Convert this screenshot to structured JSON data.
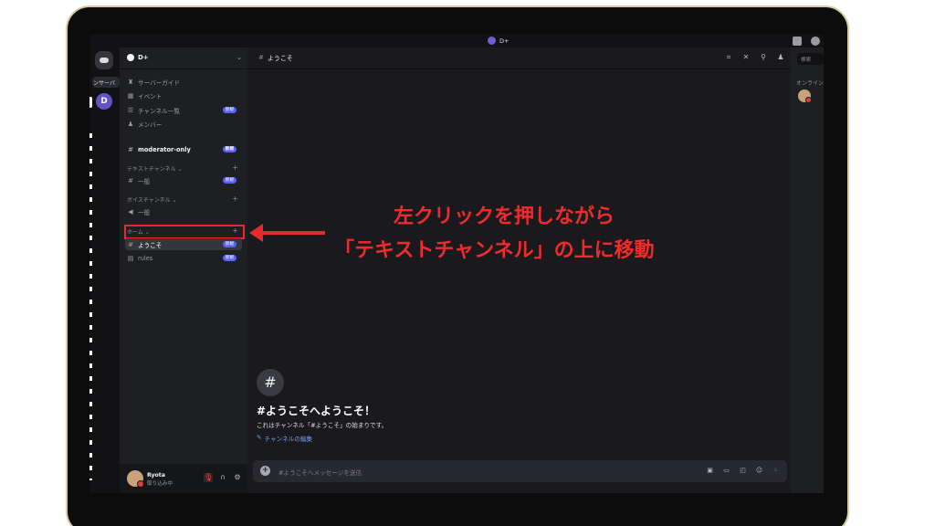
{
  "window": {
    "title": "D+"
  },
  "server_rail": {
    "server_label": "ンサーバ",
    "server_initial": "D"
  },
  "server": {
    "name": "D+"
  },
  "sidebar": {
    "top_items": [
      {
        "label": "サーバーガイド",
        "icon": "guide-icon"
      },
      {
        "label": "イベント",
        "icon": "calendar-icon"
      },
      {
        "label": "チャンネル一覧",
        "icon": "channel-list-icon",
        "badge": "新規"
      },
      {
        "label": "メンバー",
        "icon": "members-icon"
      }
    ],
    "moderator_channel": {
      "label": "moderator-only",
      "badge": "新規"
    },
    "categories": [
      {
        "label": "テキストチャンネル ⌄",
        "channels": [
          {
            "label": "一般",
            "icon": "hash-icon",
            "badge": "新規"
          }
        ]
      },
      {
        "label": "ボイスチャンネル ⌄",
        "channels": [
          {
            "label": "一般",
            "icon": "speaker-icon"
          }
        ]
      },
      {
        "label": "ホーム ⌄",
        "channels": [
          {
            "label": "ようこそ",
            "icon": "hash-icon",
            "badge": "新規"
          },
          {
            "label": "rules",
            "icon": "rules-icon",
            "badge": "新規"
          }
        ]
      }
    ]
  },
  "user": {
    "name": "Ryota",
    "status": "取り込み中"
  },
  "channel": {
    "name": "ようこそ"
  },
  "header": {
    "search_placeholder": "検索",
    "online_label": "オンライン"
  },
  "welcome": {
    "title": "#ようこそへようこそ！",
    "subtitle": "これはチャンネル「#ようこそ」の始まりです。",
    "edit_link": "チャンネルの編集"
  },
  "composer": {
    "placeholder": "#ようこそへメッセージを送信"
  },
  "annotation": {
    "line1": "左クリックを押しながら",
    "line2": "「テキストチャンネル」の上に移動",
    "color": "#e52b2b"
  }
}
